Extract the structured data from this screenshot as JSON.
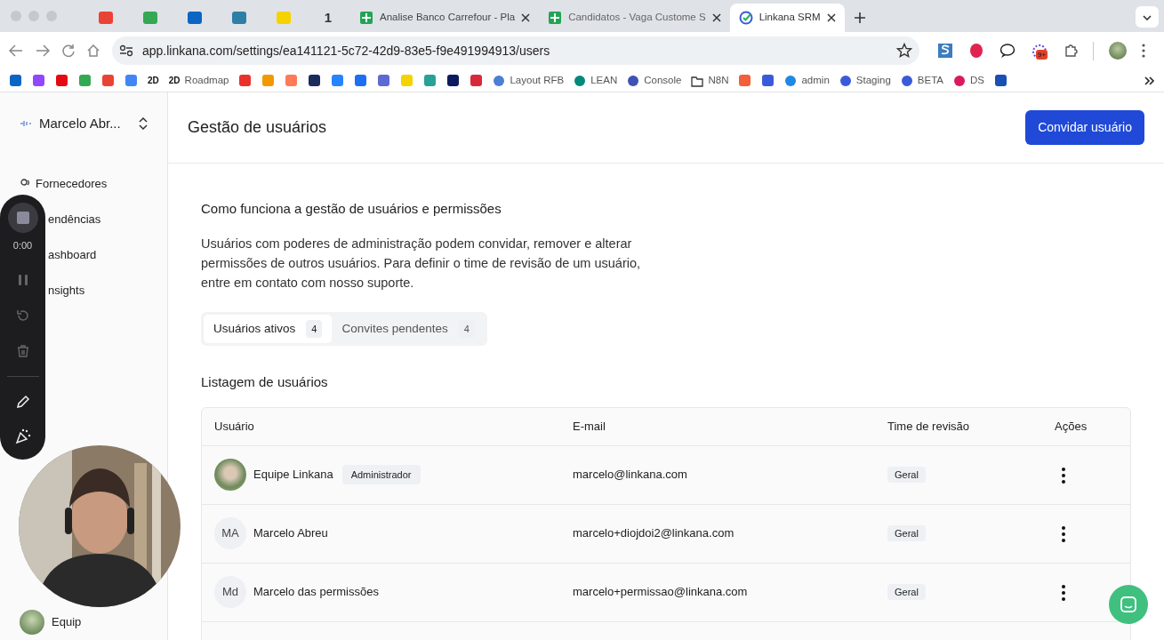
{
  "browser": {
    "tabs": [
      {
        "kind": "pinned",
        "selected": false
      },
      {
        "kind": "pinned",
        "selected": false
      },
      {
        "kind": "pinned",
        "selected": false
      },
      {
        "kind": "pinned",
        "selected": false
      },
      {
        "kind": "pinned",
        "selected": false
      },
      {
        "kind": "pinned",
        "label": "1",
        "selected": false
      },
      {
        "kind": "page",
        "label": "Analise Banco Carrefour - Pla",
        "selected": false
      },
      {
        "kind": "page",
        "label": "Candidatos - Vaga Custome S",
        "selected": false
      },
      {
        "kind": "page",
        "label": "Linkana SRM",
        "selected": true
      }
    ],
    "url": "app.linkana.com/settings/ea141121-5c72-42d9-83e5-f9e491994913/users",
    "extension_badge": "9+",
    "bookmarks": [
      {
        "kind": "icon"
      },
      {
        "kind": "icon"
      },
      {
        "kind": "icon"
      },
      {
        "kind": "icon"
      },
      {
        "kind": "icon"
      },
      {
        "kind": "icon"
      },
      {
        "kind": "text",
        "label": "2D"
      },
      {
        "kind": "link",
        "glyph": "2D",
        "label": "Roadmap"
      },
      {
        "kind": "icon"
      },
      {
        "kind": "icon"
      },
      {
        "kind": "icon"
      },
      {
        "kind": "icon"
      },
      {
        "kind": "icon"
      },
      {
        "kind": "icon"
      },
      {
        "kind": "icon"
      },
      {
        "kind": "icon"
      },
      {
        "kind": "icon"
      },
      {
        "kind": "icon"
      },
      {
        "kind": "icon"
      },
      {
        "kind": "link",
        "label": "Layout RFB"
      },
      {
        "kind": "link",
        "label": "LEAN"
      },
      {
        "kind": "link",
        "label": "Console"
      },
      {
        "kind": "link",
        "label": "N8N"
      },
      {
        "kind": "icon"
      },
      {
        "kind": "icon"
      },
      {
        "kind": "link",
        "label": "admin"
      },
      {
        "kind": "link",
        "label": "Staging"
      },
      {
        "kind": "link",
        "label": "BETA"
      },
      {
        "kind": "link",
        "label": "DS"
      },
      {
        "kind": "icon"
      }
    ]
  },
  "sidebar": {
    "workspace": "Marcelo Abr...",
    "items": [
      "Fornecedores",
      "endências",
      "ashboard",
      "nsights"
    ],
    "user": "Equip"
  },
  "recorder": {
    "time": "0:00"
  },
  "header": {
    "title": "Gestão de usuários",
    "button": "Convidar usuário"
  },
  "info": {
    "title": "Como funciona a gestão de usuários e permissões",
    "text": "Usuários com poderes de administração podem convidar, remover e alterar permissões de outros usuários. Para definir o time de revisão de um usuário, entre em contato com nosso suporte."
  },
  "tabs": [
    {
      "label": "Usuários ativos",
      "count": "4",
      "selected": true
    },
    {
      "label": "Convites pendentes",
      "count": "4",
      "selected": false
    }
  ],
  "table": {
    "title": "Listagem de usuários",
    "columns": [
      "Usuário",
      "E-mail",
      "Time de revisão",
      "Ações"
    ],
    "rows": [
      {
        "name": "Equipe Linkana",
        "role": "Administrador",
        "email": "marcelo@linkana.com",
        "team": "Geral"
      },
      {
        "avatar": {
          "kind": "initials",
          "text": "MA"
        },
        "name": "Marcelo Abreu",
        "email": "marcelo+diojdoi2@linkana.com",
        "team": "Geral"
      },
      {
        "avatar": {
          "kind": "initials",
          "text": "Md"
        },
        "name": "Marcelo das permissões",
        "email": "marcelo+permissao@linkana.com",
        "team": "Geral"
      }
    ]
  }
}
